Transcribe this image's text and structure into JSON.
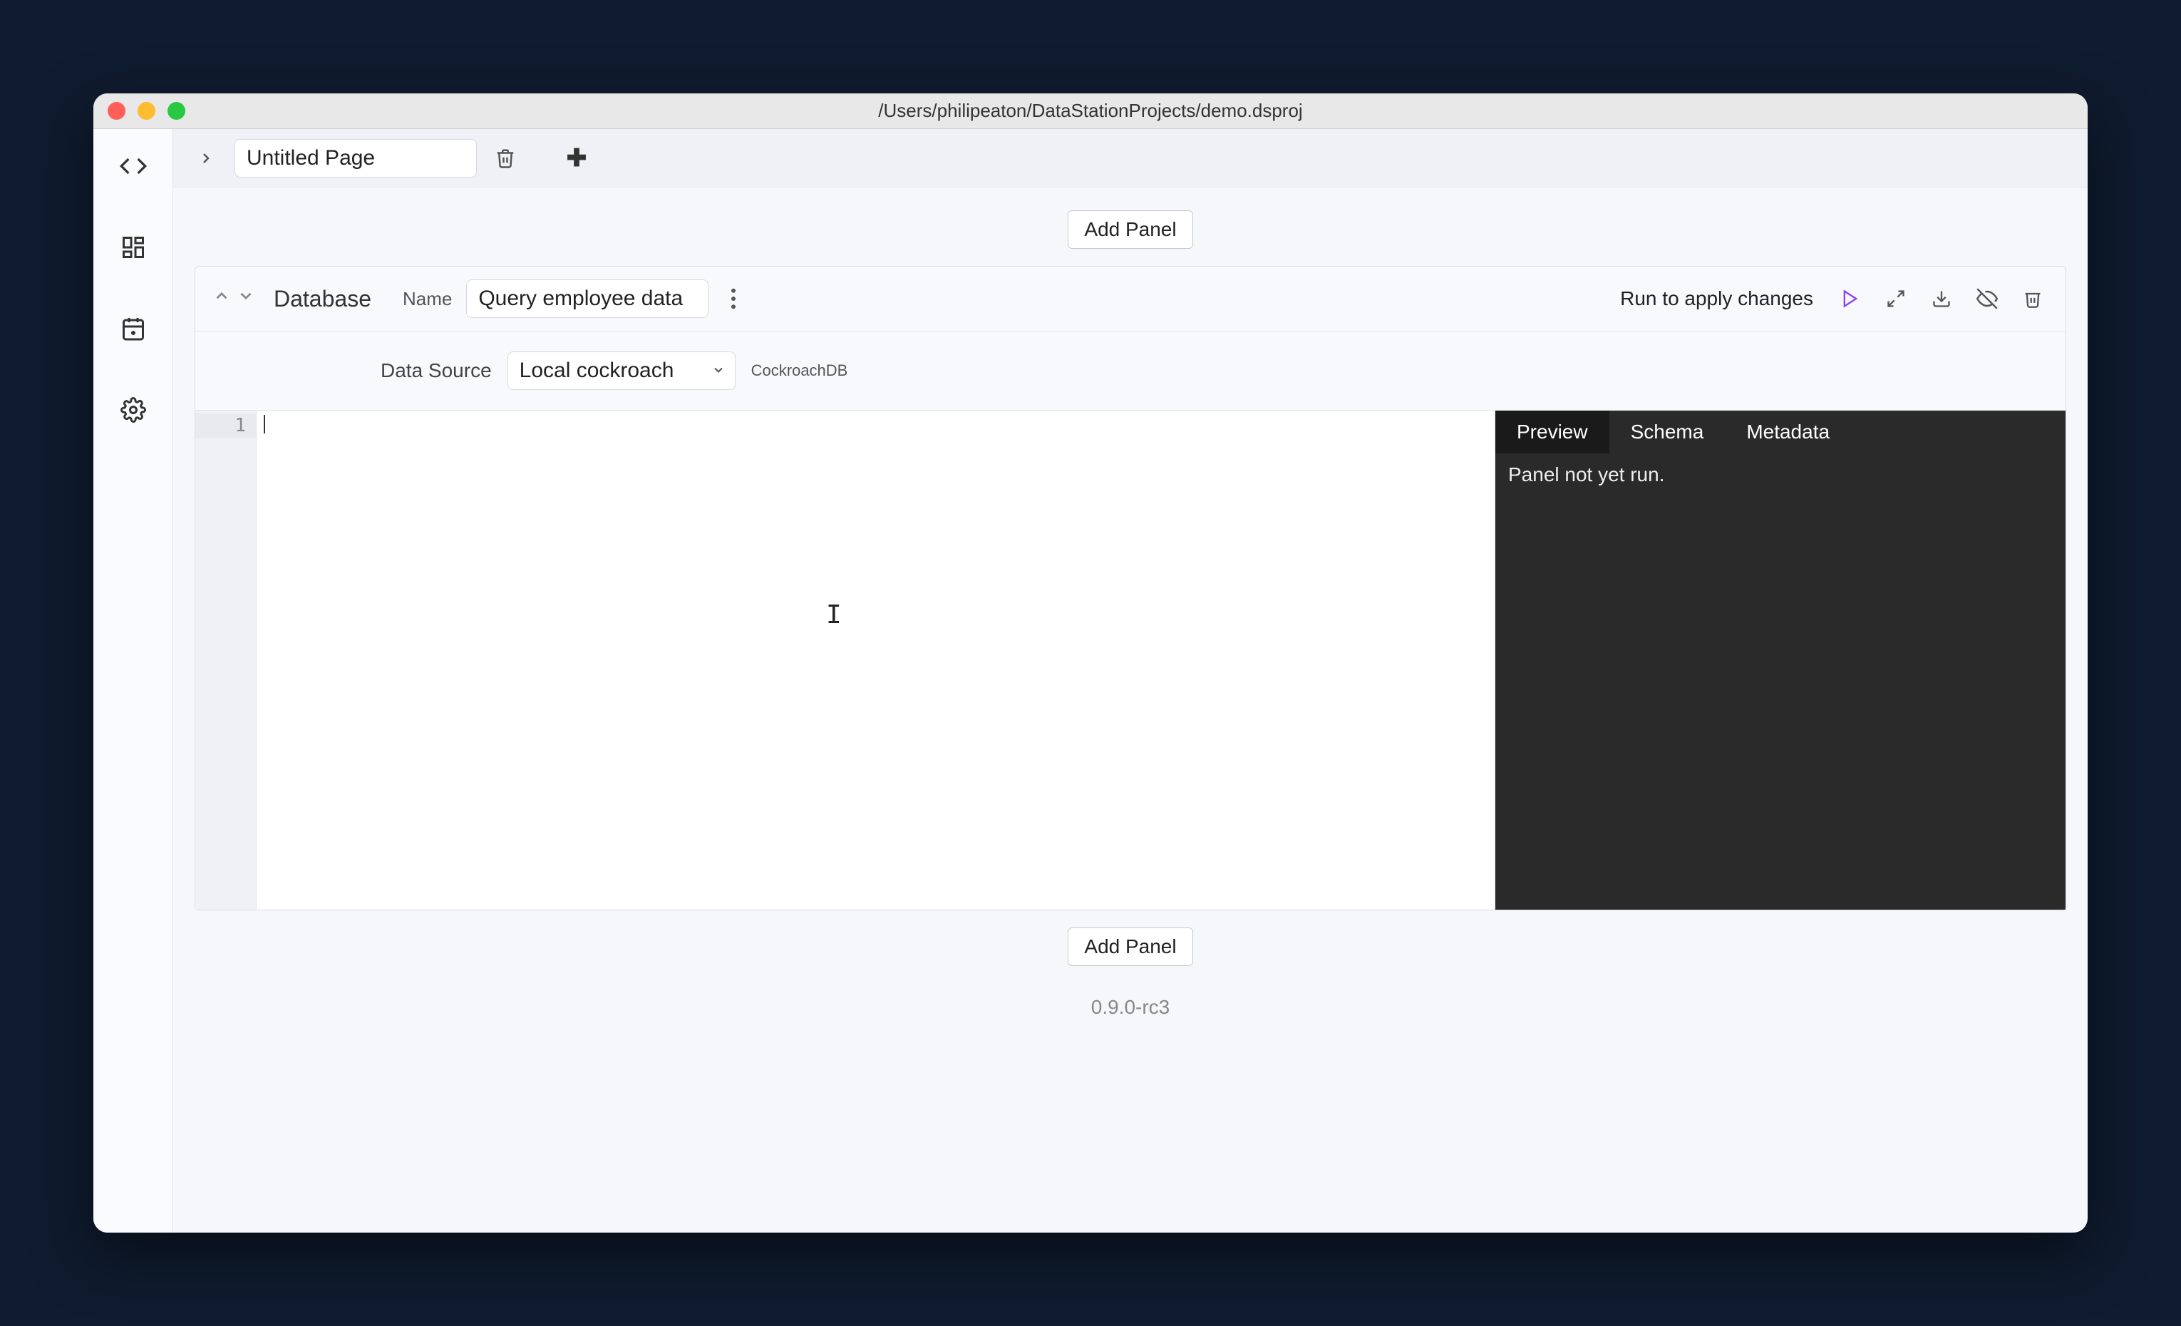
{
  "window": {
    "title": "/Users/philipeaton/DataStationProjects/demo.dsproj"
  },
  "tabs": {
    "page_name": "Untitled Page"
  },
  "toolbar": {
    "add_panel_label": "Add Panel"
  },
  "panel": {
    "type_label": "Database",
    "name_label": "Name",
    "name_value": "Query employee data",
    "run_message": "Run to apply changes",
    "data_source_label": "Data Source",
    "data_source_value": "Local cockroach",
    "db_engine": "CockroachDB",
    "editor": {
      "line_numbers": [
        "1"
      ]
    },
    "results": {
      "tabs": [
        "Preview",
        "Schema",
        "Metadata"
      ],
      "active_tab": 0,
      "message": "Panel not yet run."
    }
  },
  "footer": {
    "version": "0.9.0-rc3"
  }
}
